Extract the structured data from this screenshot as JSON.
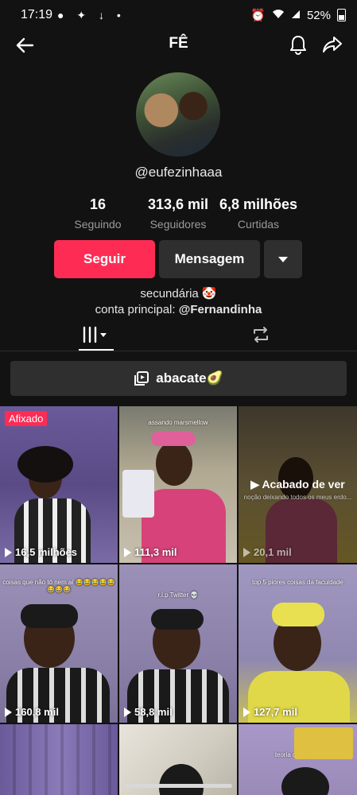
{
  "status_bar": {
    "time": "17:19",
    "left_icons": "● ✦ ↓ •",
    "battery": "52%"
  },
  "header": {
    "title": "FÊ",
    "back_icon": "back-arrow-icon",
    "bell_icon": "bell-icon",
    "share_icon": "share-icon"
  },
  "profile": {
    "username": "@eufezinhaaa",
    "stats": [
      {
        "value": "16",
        "label": "Seguindo"
      },
      {
        "value": "313,6 mil",
        "label": "Seguidores"
      },
      {
        "value": "6,8 milhões",
        "label": "Curtidas"
      }
    ],
    "buttons": {
      "follow": "Seguir",
      "message": "Mensagem"
    },
    "bio_line1": "secundária 🤡",
    "bio_line2_prefix": "conta principal: ",
    "bio_line2_handle": "@Fernandinha"
  },
  "playlist": {
    "label": "abacate🥑"
  },
  "videos": [
    {
      "views": "16,5 milhões",
      "pinned_label": "Afixado",
      "caption": ""
    },
    {
      "views": "111,3 mil",
      "caption": "assando marsmellow"
    },
    {
      "views": "20,1 mil",
      "caption": "noção deixando todos os meus erdo...",
      "watched_label": "Acabado de ver"
    },
    {
      "views": "160,8 mil",
      "caption": "coisas que não tô nem aí 😂😂😂😂😂😂😂😂"
    },
    {
      "views": "58,8 mil",
      "caption": "r.i.p Twitter 💀"
    },
    {
      "views": "127,7 mil",
      "caption": "top 5 piores coisas da faculdade"
    },
    {
      "views": "",
      "caption": ""
    },
    {
      "views": "",
      "caption": ""
    },
    {
      "views": "",
      "caption": "teoria de agosto"
    }
  ],
  "colors": {
    "accent": "#fe2c55",
    "background": "#121212",
    "button_dark": "#2f2f2f"
  }
}
